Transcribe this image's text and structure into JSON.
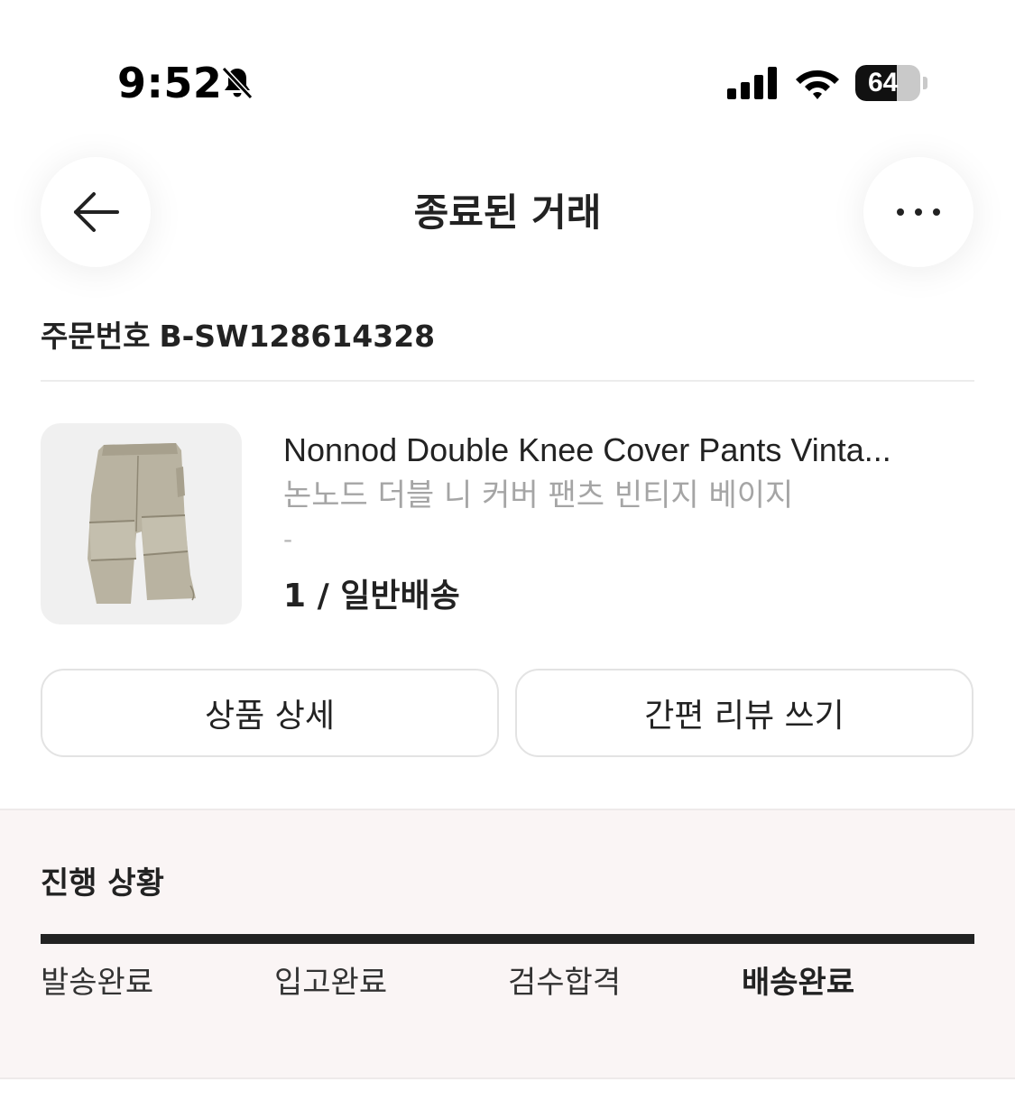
{
  "status_bar": {
    "time": "9:52",
    "battery": "64",
    "battery_level": 0.64
  },
  "header": {
    "title": "종료된 거래"
  },
  "order": {
    "label": "주문번호",
    "number": "B-SW128614328"
  },
  "product": {
    "name_en": "Nonnod Double Knee Cover Pants Vinta...",
    "name_ko": "논노드 더블 니 커버 팬츠 빈티지 베이지",
    "option": "-",
    "quantity_shipping": "1 / 일반배송"
  },
  "actions": {
    "detail_label": "상품 상세",
    "review_label": "간편 리뷰 쓰기"
  },
  "progress": {
    "title": "진행 상황",
    "completion": 1.0,
    "steps": [
      {
        "label": "발송완료",
        "active": false
      },
      {
        "label": "입고완료",
        "active": false
      },
      {
        "label": "검수합격",
        "active": false
      },
      {
        "label": "배송완료",
        "active": true
      }
    ]
  },
  "icons": {
    "back": "arrow-left-icon",
    "more": "more-horizontal-icon",
    "bell": "bell-slash-icon",
    "signal": "cellular-signal-icon",
    "wifi": "wifi-icon"
  }
}
